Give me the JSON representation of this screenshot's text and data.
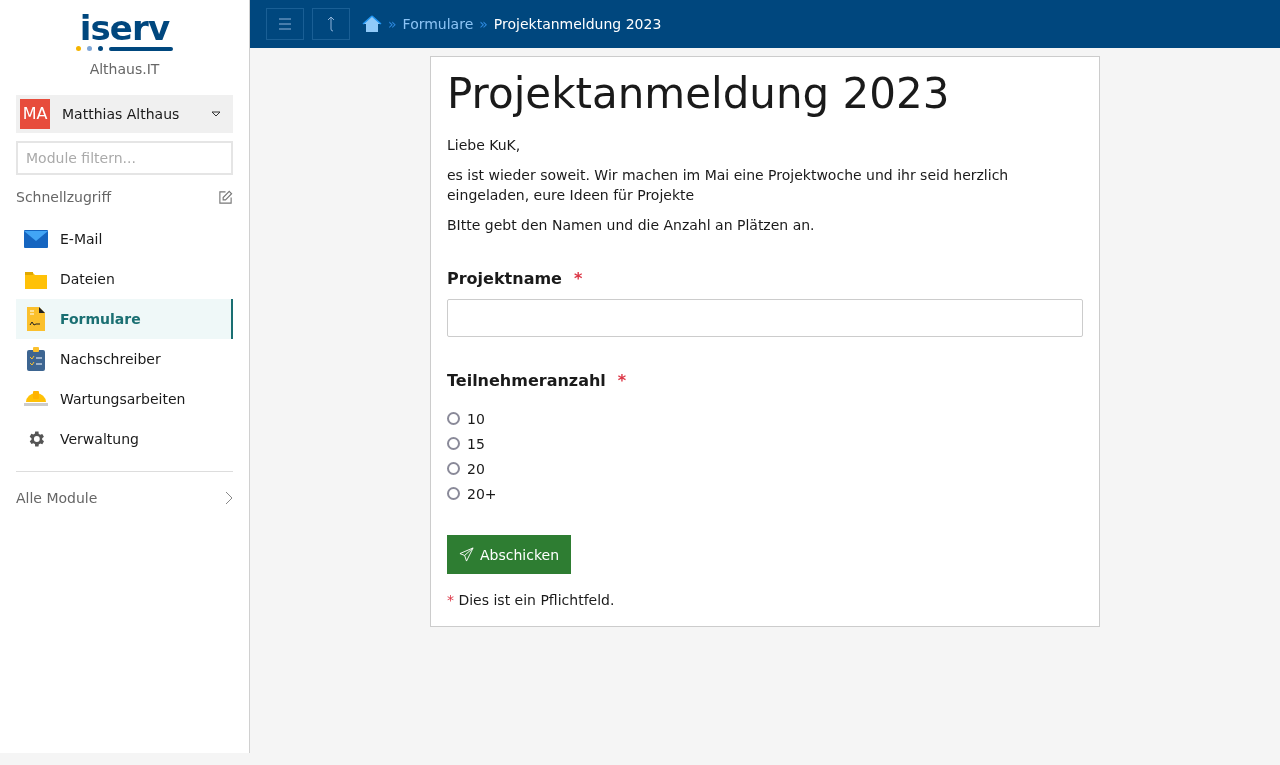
{
  "sidebar": {
    "logo": "iserv",
    "school": "Althaus.IT",
    "user": {
      "initials": "MA",
      "name": "Matthias Althaus"
    },
    "filter": {
      "placeholder": "Module filtern..."
    },
    "quick_access": "Schnellzugriff",
    "items": [
      {
        "kind": "mail",
        "label": "E-Mail",
        "selected": false
      },
      {
        "kind": "folder",
        "label": "Dateien",
        "selected": false
      },
      {
        "kind": "form",
        "label": "Formulare",
        "selected": true
      },
      {
        "kind": "clipboard",
        "label": "Nachschreiber",
        "selected": false
      },
      {
        "kind": "helmet",
        "label": "Wartungsarbeiten",
        "selected": false
      },
      {
        "kind": "gear",
        "label": "Verwaltung",
        "selected": false
      }
    ],
    "all_modules": "Alle Module"
  },
  "breadcrumb": [
    {
      "separator": "»",
      "label": "Formulare",
      "current": false
    },
    {
      "separator": "»",
      "label": "Projektanmeldung 2023",
      "current": true
    }
  ],
  "form": {
    "title": "Projektanmeldung 2023",
    "intro": [
      "Liebe KuK,",
      "es ist wieder soweit. Wir machen im Mai eine Projektwoche und ihr seid herzlich eingeladen, eure Ideen für Projekte",
      "BItte gebt den Namen und die Anzahl an Plätzen an."
    ],
    "fields": [
      {
        "kind": "text",
        "label": "Projektname",
        "required": true
      },
      {
        "kind": "radio",
        "label": "Teilnehmeranzahl",
        "required": true,
        "options": [
          {
            "label": "10",
            "selected": false
          },
          {
            "label": "15",
            "selected": false
          },
          {
            "label": "20",
            "selected": false
          },
          {
            "label": "20+",
            "selected": false
          }
        ]
      }
    ],
    "submit": "Abschicken",
    "required_note": {
      "mark": "*",
      "text": "Dies ist ein Pflichtfeld."
    }
  }
}
